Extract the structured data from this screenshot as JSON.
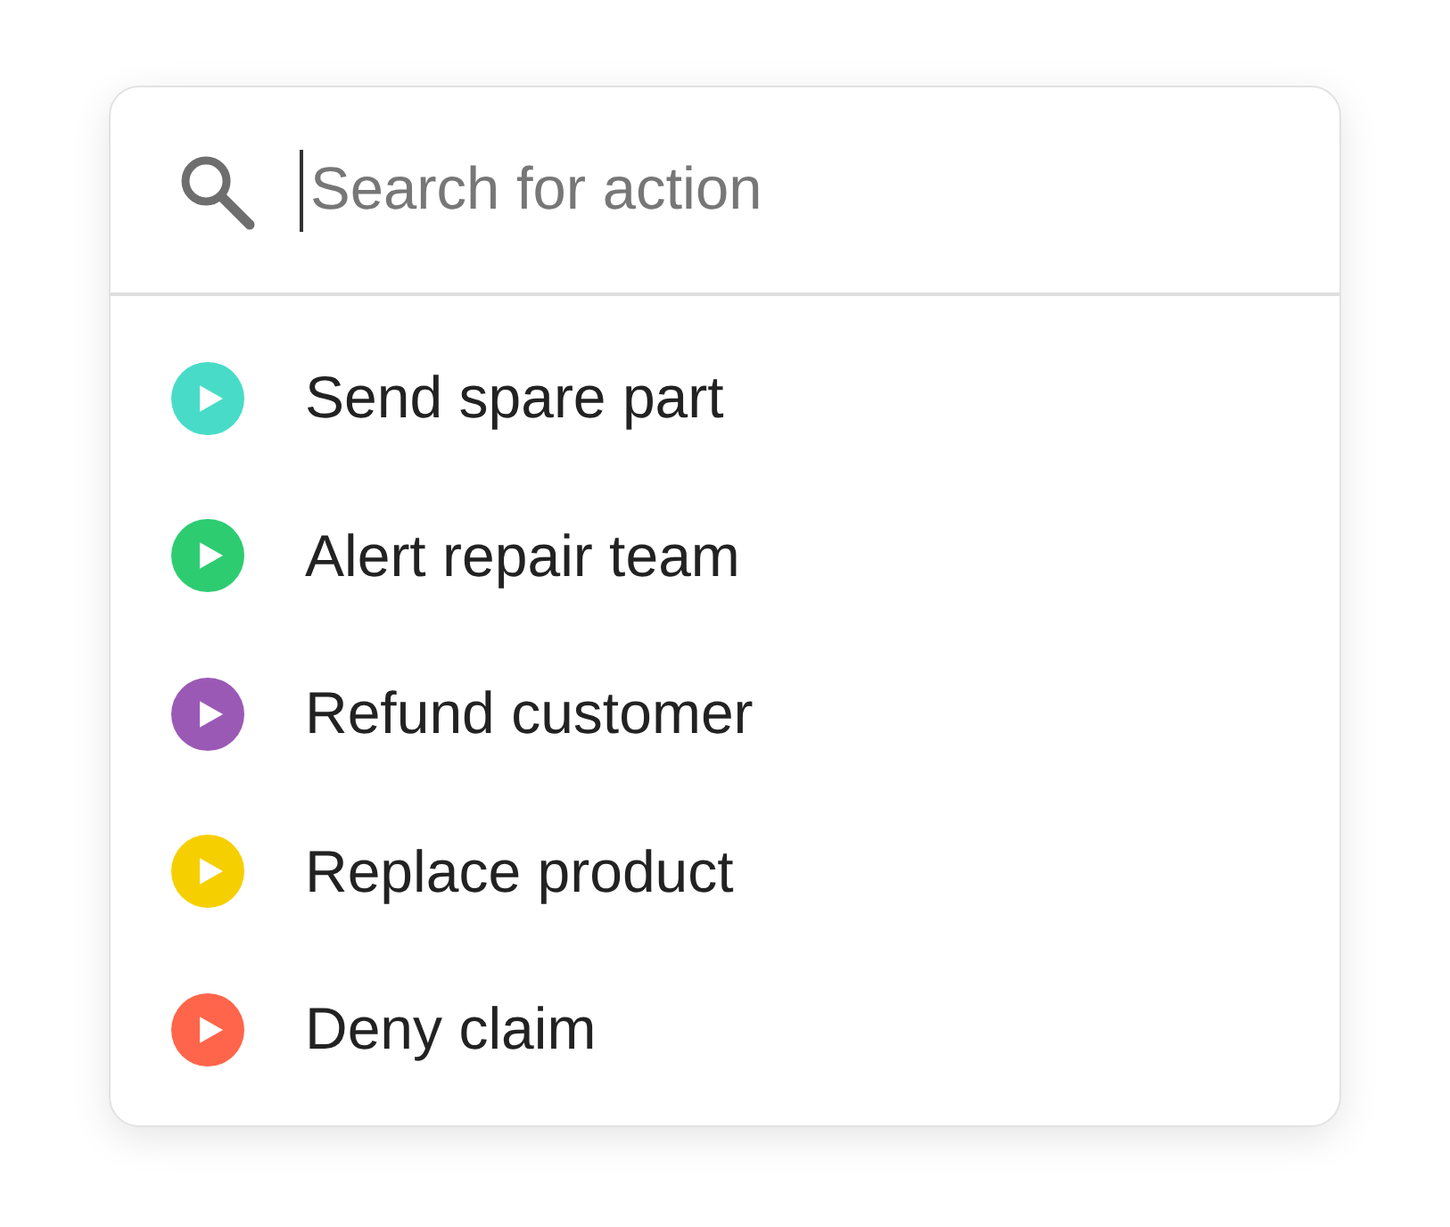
{
  "search": {
    "placeholder": "Search for action",
    "focused": true
  },
  "actions": [
    {
      "label": "Send spare part",
      "color": "#48dcc8"
    },
    {
      "label": "Alert repair team",
      "color": "#2ecc71"
    },
    {
      "label": "Refund customer",
      "color": "#9b59b6"
    },
    {
      "label": "Replace product",
      "color": "#f6cf00"
    },
    {
      "label": "Deny claim",
      "color": "#ff654a"
    }
  ]
}
